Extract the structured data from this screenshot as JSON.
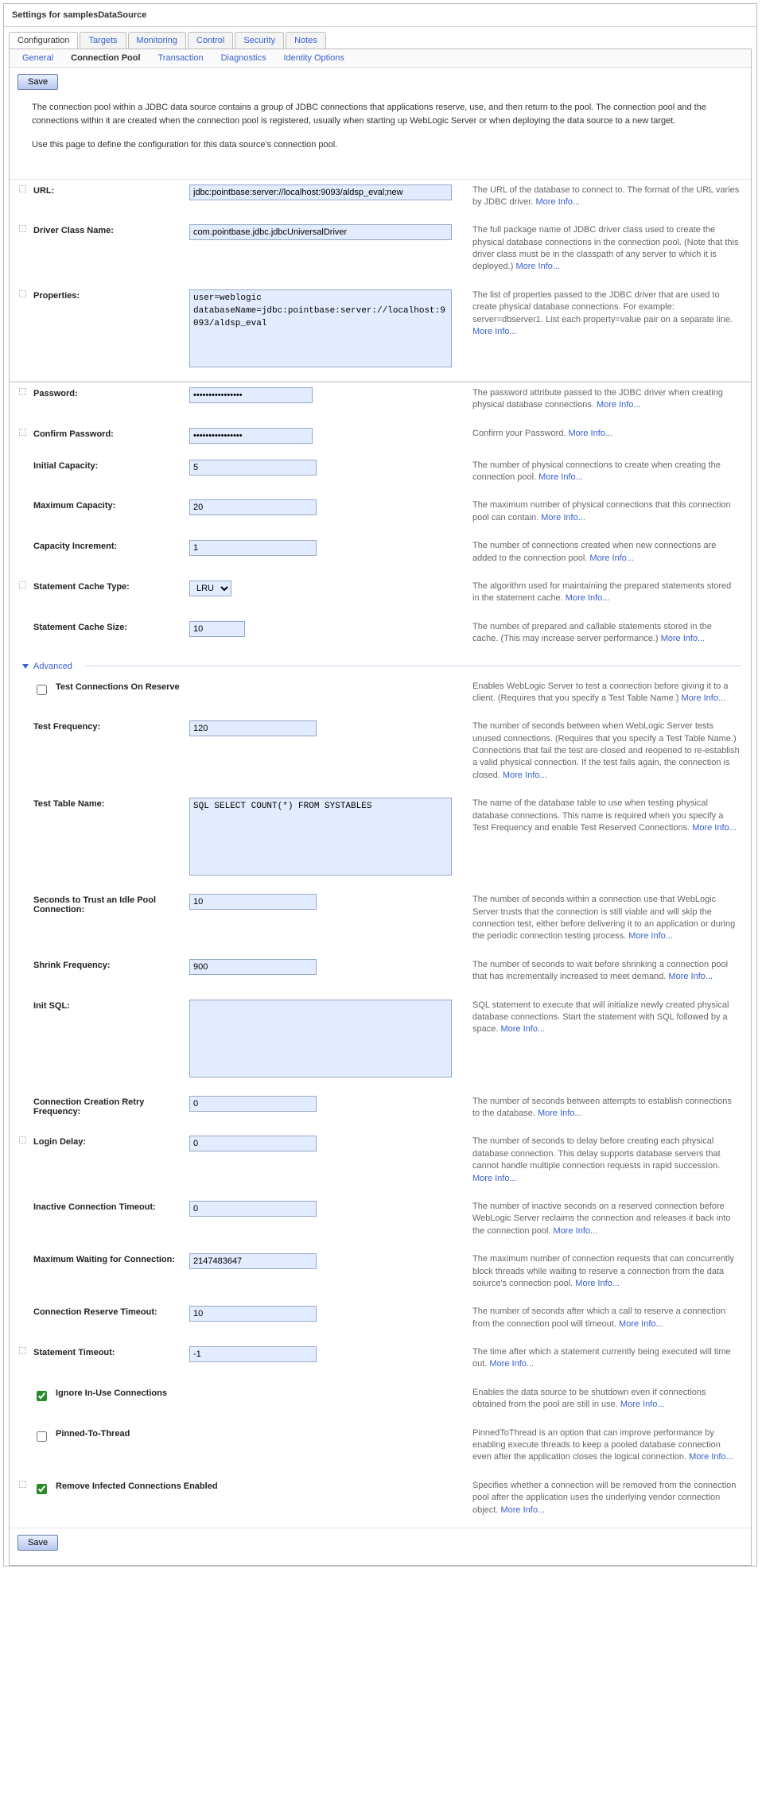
{
  "title": "Settings for samplesDataSource",
  "tabs": [
    "Configuration",
    "Targets",
    "Monitoring",
    "Control",
    "Security",
    "Notes"
  ],
  "activeTab": 0,
  "subtabs": [
    "General",
    "Connection Pool",
    "Transaction",
    "Diagnostics",
    "Identity Options"
  ],
  "activeSubtab": 1,
  "saveLabel": "Save",
  "moreInfo": "More Info...",
  "intro1": "The connection pool within a JDBC data source contains a group of JDBC connections that applications reserve, use, and then return to the pool. The connection pool and the connections within it are created when the connection pool is registered, usually when starting up WebLogic Server or when deploying the data source to a new target.",
  "intro2": "Use this page to define the configuration for this data source's connection pool.",
  "advancedLabel": "Advanced",
  "fields": {
    "url": {
      "label": "URL:",
      "value": "jdbc:pointbase:server://localhost:9093/aldsp_eval;new",
      "help": "The URL of the database to connect to. The format of the URL varies by JDBC driver."
    },
    "driver": {
      "label": "Driver Class Name:",
      "value": "com.pointbase.jdbc.jdbcUniversalDriver",
      "help": "The full package name of JDBC driver class used to create the physical database connections in the connection pool. (Note that this driver class must be in the classpath of any server to which it is deployed.)"
    },
    "properties": {
      "label": "Properties:",
      "value": "user=weblogic\ndatabaseName=jdbc:pointbase:server://localhost:9093/aldsp_eval",
      "help": "The list of properties passed to the JDBC driver that are used to create physical database connections. For example: server=dbserver1. List each property=value pair on a separate line."
    },
    "password": {
      "label": "Password:",
      "value": "••••••••••••••••",
      "help": "The password attribute passed to the JDBC driver when creating physical database connections."
    },
    "confirm": {
      "label": "Confirm Password:",
      "value": "••••••••••••••••",
      "help": "Confirm your Password."
    },
    "initialCapacity": {
      "label": "Initial Capacity:",
      "value": "5",
      "help": "The number of physical connections to create when creating the connection pool."
    },
    "maxCapacity": {
      "label": "Maximum Capacity:",
      "value": "20",
      "help": "The maximum number of physical connections that this connection pool can contain."
    },
    "capIncrement": {
      "label": "Capacity Increment:",
      "value": "1",
      "help": "The number of connections created when new connections are added to the connection pool."
    },
    "cacheType": {
      "label": "Statement Cache Type:",
      "value": "LRU",
      "help": "The algorithm used for maintaining the prepared statements stored in the statement cache."
    },
    "cacheSize": {
      "label": "Statement Cache Size:",
      "value": "10",
      "help": "The number of prepared and callable statements stored in the cache. (This may increase server performance.)"
    },
    "testOnReserve": {
      "label": "Test Connections On Reserve",
      "checked": false,
      "help": "Enables WebLogic Server to test a connection before giving it to a client. (Requires that you specify a Test Table Name.)"
    },
    "testFreq": {
      "label": "Test Frequency:",
      "value": "120",
      "help": "The number of seconds between when WebLogic Server tests unused connections. (Requires that you specify a Test Table Name.) Connections that fail the test are closed and reopened to re-establish a valid physical connection. If the test fails again, the connection is closed."
    },
    "testTable": {
      "label": "Test Table Name:",
      "value": "SQL SELECT COUNT(*) FROM SYSTABLES",
      "help": "The name of the database table to use when testing physical database connections. This name is required when you specify a Test Frequency and enable Test Reserved Connections."
    },
    "trustIdle": {
      "label": "Seconds to Trust an Idle Pool Connection:",
      "value": "10",
      "help": "The number of seconds within a connection use that WebLogic Server trusts that the connection is still viable and will skip the connection test, either before delivering it to an application or during the periodic connection testing process."
    },
    "shrinkFreq": {
      "label": "Shrink Frequency:",
      "value": "900",
      "help": "The number of seconds to wait before shrinking a connection pool that has incrementally increased to meet demand."
    },
    "initSql": {
      "label": "Init SQL:",
      "value": "",
      "help": "SQL statement to execute that will initialize newly created physical database connections. Start the statement with SQL followed by a space."
    },
    "retryFreq": {
      "label": "Connection Creation Retry Frequency:",
      "value": "0",
      "help": "The number of seconds between attempts to establish connections to the database."
    },
    "loginDelay": {
      "label": "Login Delay:",
      "value": "0",
      "help": "The number of seconds to delay before creating each physical database connection. This delay supports database servers that cannot handle multiple connection requests in rapid succession."
    },
    "inactiveTimeout": {
      "label": "Inactive Connection Timeout:",
      "value": "0",
      "help": "The number of inactive seconds on a reserved connection before WebLogic Server reclaims the connection and releases it back into the connection pool."
    },
    "maxWaiting": {
      "label": "Maximum Waiting for Connection:",
      "value": "2147483647",
      "help": "The maximum number of connection requests that can concurrently block threads while waiting to reserve a connection from the data soiurce's connection pool."
    },
    "reserveTimeout": {
      "label": "Connection Reserve Timeout:",
      "value": "10",
      "help": "The number of seconds after which a call to reserve a connection from the connection pool will timeout."
    },
    "stmtTimeout": {
      "label": "Statement Timeout:",
      "value": "-1",
      "help": "The time after which a statement currently being executed will time out."
    },
    "ignoreInUse": {
      "label": "Ignore In-Use Connections",
      "checked": true,
      "help": "Enables the data source to be shutdown even if connections obtained from the pool are still in use."
    },
    "pinned": {
      "label": "Pinned-To-Thread",
      "checked": false,
      "help": "PinnedToThread is an option that can improve performance by enabling execute threads to keep a pooled database connection even after the application closes the logical connection."
    },
    "removeInfected": {
      "label": "Remove Infected Connections Enabled",
      "checked": true,
      "help": "Specifies whether a connection will be removed from the connection pool after the application uses the underlying vendor connection object."
    }
  }
}
